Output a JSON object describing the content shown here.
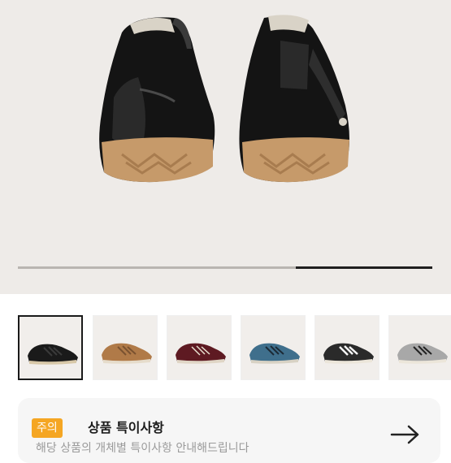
{
  "gallery": {
    "main_image_icon": "sneaker-pair-rear-icon",
    "progress_fraction": 0.33,
    "thumbnails": [
      {
        "name": "thumb-black-shoe",
        "colorway": "black",
        "selected": true
      },
      {
        "name": "thumb-tan-shoe",
        "colorway": "tan",
        "selected": false
      },
      {
        "name": "thumb-maroon-shoe",
        "colorway": "maroon",
        "selected": false
      },
      {
        "name": "thumb-blue-shoe",
        "colorway": "blue",
        "selected": false
      },
      {
        "name": "thumb-black-white-shoe",
        "colorway": "black-white",
        "selected": false
      },
      {
        "name": "thumb-grey-shoe",
        "colorway": "grey",
        "selected": false
      }
    ]
  },
  "notice": {
    "badge": "주의",
    "title": "상품 특이사항",
    "subtitle": "해당 상품의 개체별 특이사항 안내해드립니다",
    "arrow_icon": "arrow-right-icon"
  },
  "colors": {
    "badge": "#f5a623",
    "hero_background": "#eeebe8",
    "notice_background": "#f6f6f6"
  }
}
